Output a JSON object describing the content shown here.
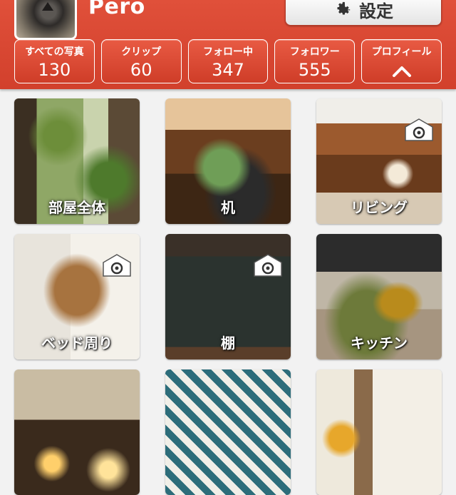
{
  "header": {
    "username": "Pero",
    "settings_label": "設定",
    "settings_icon": "gear-icon",
    "avatar_icon": "cat-avatar"
  },
  "stats": [
    {
      "label": "すべての写真",
      "value": "130"
    },
    {
      "label": "クリップ",
      "value": "60"
    },
    {
      "label": "フォロー中",
      "value": "347"
    },
    {
      "label": "フォロワー",
      "value": "555"
    },
    {
      "label": "プロフィール",
      "value": ""
    }
  ],
  "tiles": [
    {
      "label": "部屋全体",
      "has_camera": false
    },
    {
      "label": "机",
      "has_camera": false
    },
    {
      "label": "リビング",
      "has_camera": true
    },
    {
      "label": "ベッド周り",
      "has_camera": true
    },
    {
      "label": "棚",
      "has_camera": true
    },
    {
      "label": "キッチン",
      "has_camera": false
    },
    {
      "label": "",
      "has_camera": false
    },
    {
      "label": "",
      "has_camera": false
    },
    {
      "label": "",
      "has_camera": false
    }
  ],
  "colors": {
    "header_red": "#d94a35",
    "tile_label": "#ffffff",
    "background": "#f2f2f2"
  }
}
